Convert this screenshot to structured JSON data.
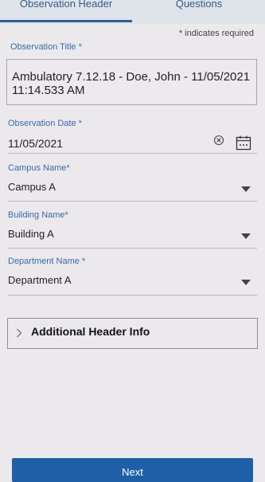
{
  "tabs": [
    {
      "label": "Observation Header",
      "active": true
    },
    {
      "label": "Questions",
      "active": false
    }
  ],
  "required_note": "* indicates required",
  "observation_title": {
    "label": "Observation Title *",
    "value": "Ambulatory 7.12.18 - Doe, John - 11/05/2021 11:14.533  AM"
  },
  "observation_date": {
    "label": "Observation Date *",
    "value": "11/05/2021",
    "icons": [
      "clear-icon",
      "calendar-icon"
    ]
  },
  "campus": {
    "label": "Campus  Name*",
    "value": "Campus A"
  },
  "building": {
    "label": "Building  Name*",
    "value": "Building A"
  },
  "department": {
    "label": "Department Name *",
    "value": "Department A"
  },
  "additional_header": {
    "label": "Additional Header Info",
    "icon": "chevron-right-icon"
  },
  "next_button": {
    "label": "Next"
  },
  "colors": {
    "accent": "#2c5e9c",
    "background": "#ebe9ec",
    "button": "#1f5fa8",
    "label": "#3a6aa8"
  }
}
